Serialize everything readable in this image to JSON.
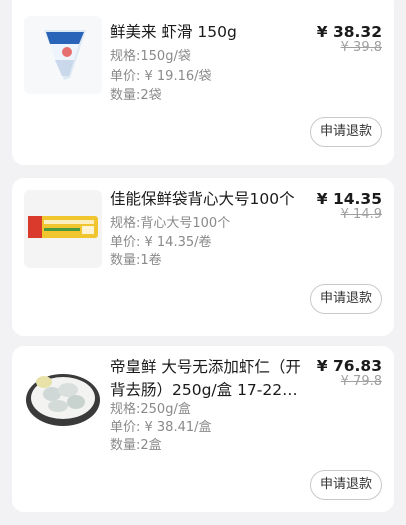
{
  "items": [
    {
      "title": "鲜美来 虾滑 150g",
      "price": "¥ 38.32",
      "original_price": "¥ 39.8",
      "spec": "规格:150g/袋",
      "unit_price": "单价: ¥ 19.16/袋",
      "quantity": "数量:2袋",
      "refund_label": "申请退款"
    },
    {
      "title": "佳能保鲜袋背心大号100个",
      "price": "¥ 14.35",
      "original_price": "¥ 14.9",
      "spec": "规格:背心大号100个",
      "unit_price": "单价: ¥ 14.35/卷",
      "quantity": "数量:1卷",
      "refund_label": "申请退款"
    },
    {
      "title": "帝皇鲜 大号无添加虾仁（开背去肠）250g/盒 17-22…",
      "price": "¥ 76.83",
      "original_price": "¥ 79.8",
      "spec": "规格:250g/盒",
      "unit_price": "单价: ¥ 38.41/盒",
      "quantity": "数量:2盒",
      "refund_label": "申请退款"
    }
  ]
}
